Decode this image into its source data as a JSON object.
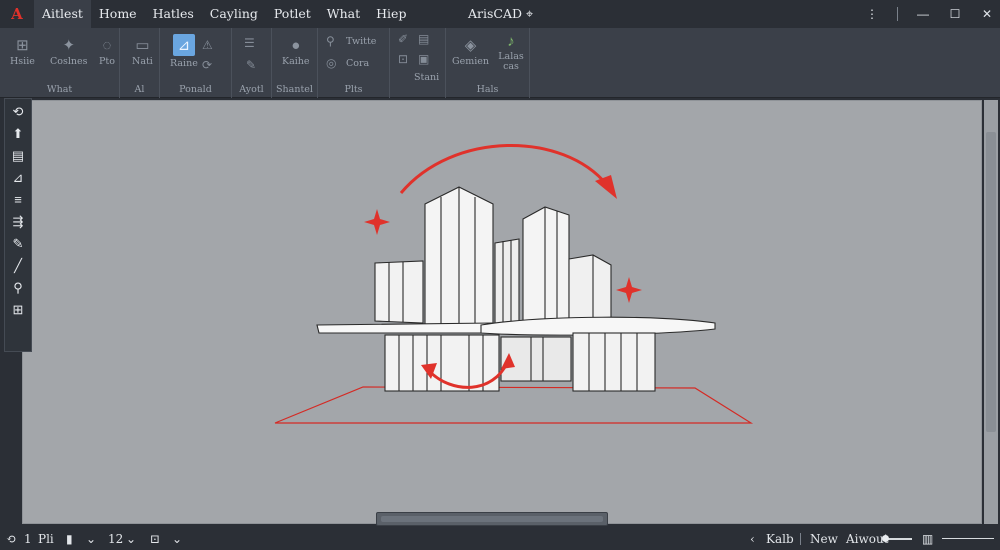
{
  "app": {
    "logo": "A",
    "title": "ArisCAD ⌖"
  },
  "menu": [
    "Aitlest",
    "Home",
    "Hatles",
    "Cayling",
    "Potlet",
    "What",
    "Hiep"
  ],
  "window_controls": {
    "minimize": "—",
    "restore": "☐",
    "close": "✕"
  },
  "ribbon": {
    "groups": [
      {
        "title": "What",
        "tools": [
          "Hsiie",
          "Coslnes",
          "Pto",
          "Nati"
        ]
      },
      {
        "title": "Al",
        "tools": []
      },
      {
        "title": "Ponald",
        "tools": [
          "Raine"
        ]
      },
      {
        "title": "Ayotl",
        "tools": []
      },
      {
        "title": "Shantel",
        "tools": [
          "Kaihe"
        ]
      },
      {
        "title": "Plts",
        "tools": [
          "Twitte",
          "Cora"
        ]
      },
      {
        "title": "",
        "tools": [
          "Stani"
        ]
      },
      {
        "title": "Hals",
        "tools": [
          "Gemien",
          "Lalas cas"
        ]
      }
    ]
  },
  "status": {
    "left_num": "1",
    "page": "Pli",
    "zoom": "12",
    "right_a": "Kalb",
    "right_b": "New",
    "right_c": "Aiwout"
  },
  "colors": {
    "viewport_bg": "#a3a6aa",
    "annotation_red": "#e0322b",
    "chrome_dark": "#2b2f36",
    "ribbon_bg": "#3b4049",
    "active_tool": "#6aa6e0"
  },
  "icons": {
    "toolstrip": [
      "orbit-icon",
      "pan-icon",
      "layer-icon",
      "shape-icon",
      "lines-icon",
      "fly-icon",
      "pencil-icon",
      "line-icon",
      "magnifier-icon",
      "grid-icon"
    ]
  }
}
